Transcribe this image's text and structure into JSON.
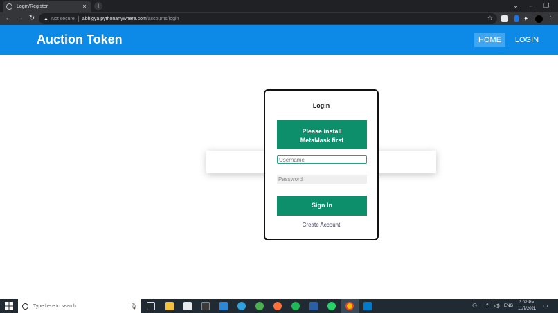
{
  "browser": {
    "tab_title": "Login/Register",
    "tab_close": "×",
    "new_tab": "+",
    "window_controls": {
      "minimize": "–",
      "restore": "❐",
      "close": "✕",
      "menu": "⌄"
    },
    "nav": {
      "back": "←",
      "forward": "→",
      "reload": "↻"
    },
    "security_icon": "warning-triangle-icon",
    "security_label": "Not secure",
    "url_host": "abhigya.pythonanywhere.com",
    "url_path": "/accounts/login",
    "bookmark_icon": "star-icon",
    "extensions": [
      "qr-icon",
      "clipboard-icon",
      "puzzle-icon",
      "profile-avatar",
      "menu-dots-icon"
    ]
  },
  "site": {
    "brand": "Auction Token",
    "nav": {
      "home": "HOME",
      "login": "LOGIN"
    }
  },
  "login_card": {
    "title": "Login",
    "metamask_line1": "Please install",
    "metamask_line2": "MetaMask first",
    "username_placeholder": "Username",
    "password_placeholder": "Password",
    "signin_label": "Sign In",
    "create_account": "Create Account"
  },
  "colors": {
    "navbar": "#0d8ae8",
    "nav_active": "#40a6f0",
    "button_green": "#0d8f6c",
    "input_focus": "#1aa683"
  },
  "taskbar": {
    "search_placeholder": "Type here to search",
    "apps": [
      "task-view-icon",
      "file-explorer-icon",
      "store-icon",
      "notion-icon",
      "mail-icon",
      "edge-icon",
      "vpn-icon",
      "firefox-icon",
      "spotify-icon",
      "powershell-icon",
      "whatsapp-icon",
      "chrome-icon",
      "vscode-icon"
    ],
    "language": "ENG",
    "time": "3:02 PM",
    "date": "11/7/2021"
  }
}
